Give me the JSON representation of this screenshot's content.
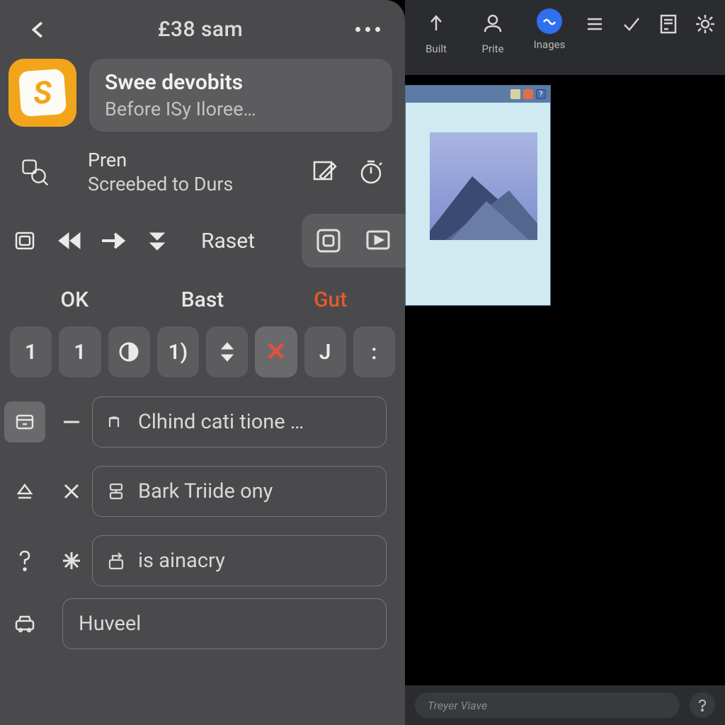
{
  "header": {
    "time": "£38 sam"
  },
  "card": {
    "title": "Swee devobits",
    "subtitle": "Before ISy Iloree…"
  },
  "pren": {
    "line1": "Pren",
    "line2": "Screebed to Durs"
  },
  "toolbar": {
    "raset": "Raset"
  },
  "tabs": {
    "ok": "OK",
    "bast": "Bast",
    "gut": "Gut"
  },
  "keys": {
    "k1": "1",
    "k2": "1",
    "k5b": "1)",
    "k8": "J",
    "k9": ":"
  },
  "list": {
    "row1": "Clhind cati tione …",
    "row2": "Bark Triide ony",
    "row3": "is ainacry",
    "row4": "Huveel"
  },
  "topbar": {
    "built": "Built",
    "prite": "Prite",
    "images": "Inages"
  },
  "bottombar": {
    "placeholder": "Treyer Viave"
  }
}
